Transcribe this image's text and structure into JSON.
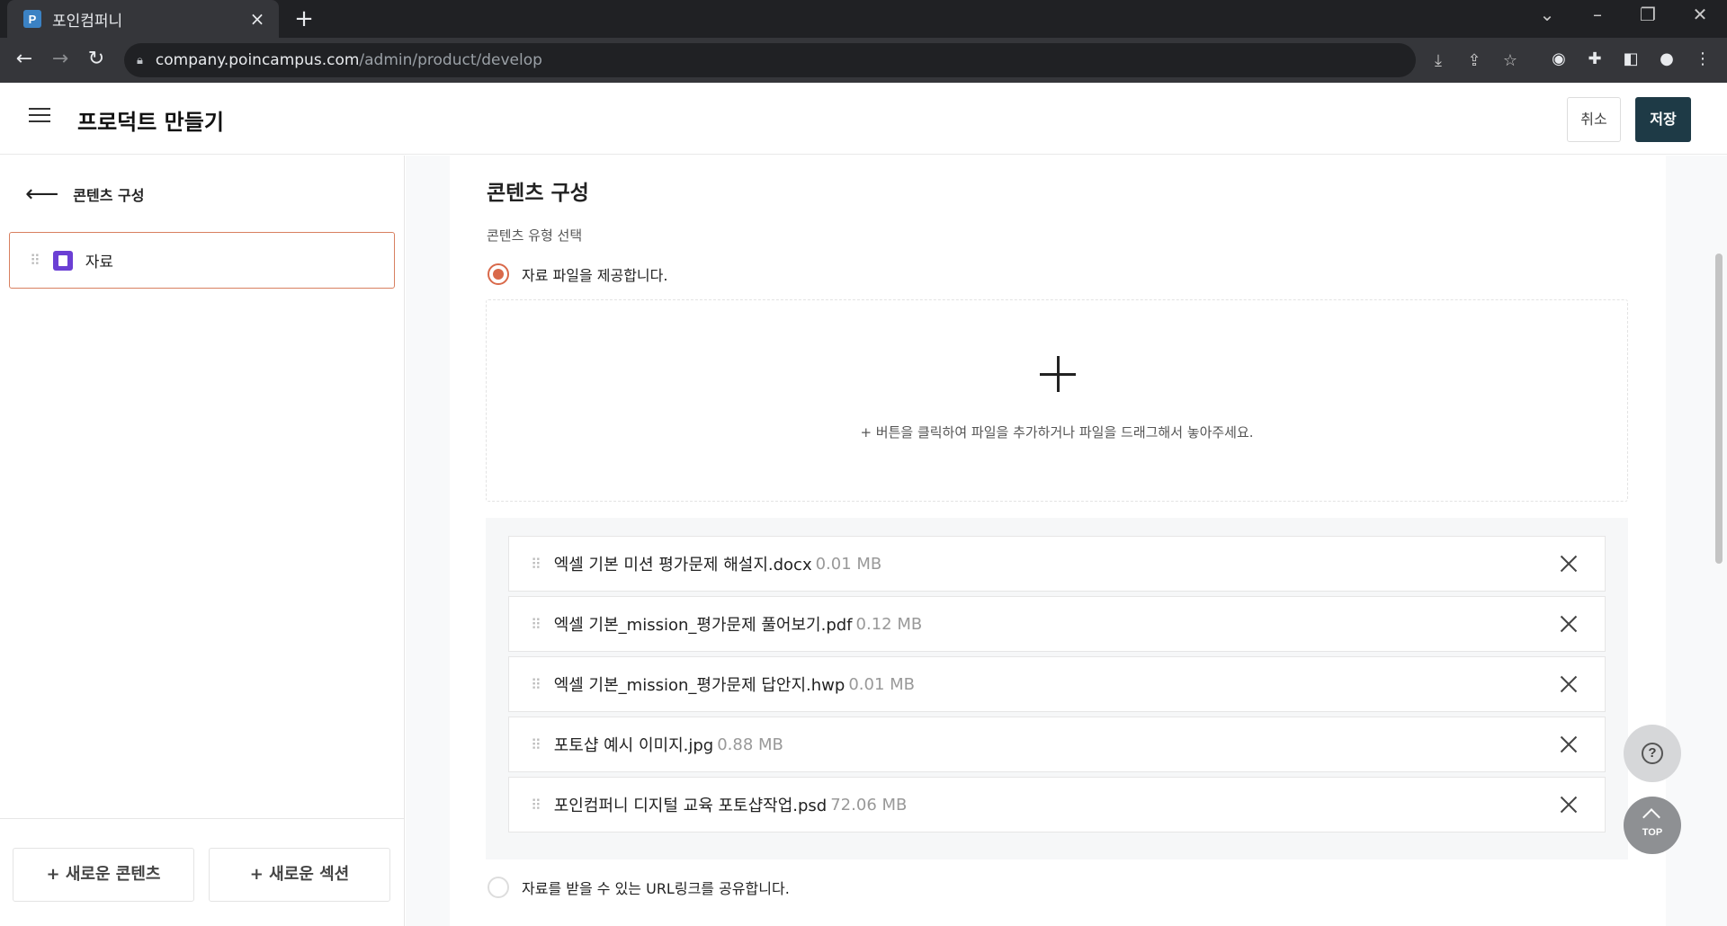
{
  "browser": {
    "tab_title": "포인컴퍼니",
    "favicon_letter": "P",
    "url_host": "company.poincampus.com",
    "url_path": "/admin/product/develop"
  },
  "header": {
    "title": "프로덕트 만들기",
    "cancel_label": "취소",
    "save_label": "저장"
  },
  "sidebar": {
    "back_label": "콘텐츠 구성",
    "items": [
      {
        "label": "자료"
      }
    ],
    "new_content_label": "+ 새로운 콘텐츠",
    "new_section_label": "+ 새로운 섹션"
  },
  "main": {
    "section_title": "콘텐츠 구성",
    "type_label": "콘텐츠 유형 선택",
    "option_file": "자료 파일을 제공합니다.",
    "option_url": "자료를 받을 수 있는 URL링크를 공유합니다.",
    "drop_hint": "+ 버튼을 클릭하여 파일을 추가하거나 파일을 드래그해서 놓아주세요.",
    "files": [
      {
        "name": "엑셀 기본 미션 평가문제 해설지.docx",
        "size": "0.01 MB"
      },
      {
        "name": "엑셀 기본_mission_평가문제 풀어보기.pdf",
        "size": "0.12 MB"
      },
      {
        "name": "엑셀 기본_mission_평가문제 답안지.hwp",
        "size": "0.01 MB"
      },
      {
        "name": "포토샵 예시 이미지.jpg",
        "size": "0.88 MB"
      },
      {
        "name": "포인컴퍼니 디지털 교육 포토샵작업.psd",
        "size": "72.06 MB"
      }
    ]
  },
  "floating": {
    "help_symbol": "?",
    "top_label": "TOP"
  },
  "colors": {
    "accent": "#d9694a",
    "save_button": "#1e3a46",
    "content_icon": "#6b3fd4"
  }
}
